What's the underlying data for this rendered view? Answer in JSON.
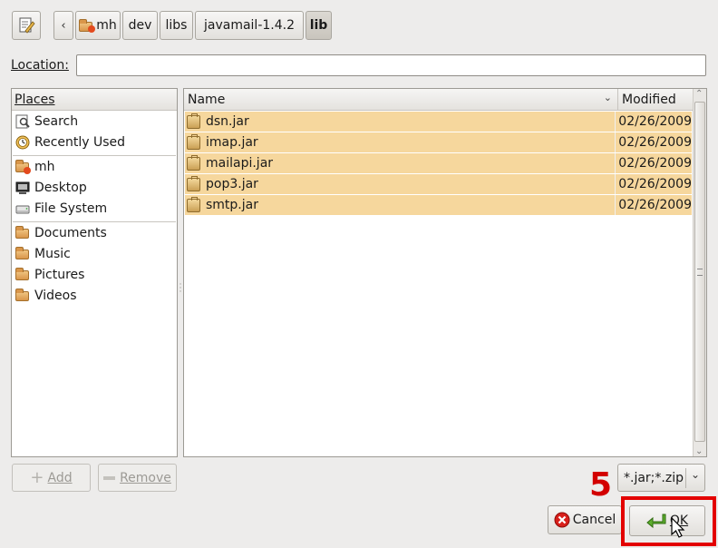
{
  "path_bar": {
    "buttons": [
      "mh",
      "dev",
      "libs",
      "javamail-1.4.2",
      "lib"
    ]
  },
  "location": {
    "label": "Location:",
    "value": ""
  },
  "places": {
    "header": "Places",
    "items": [
      {
        "label": "Search",
        "icon": "search-icon"
      },
      {
        "label": "Recently Used",
        "icon": "recent-icon"
      },
      {
        "label": "mh",
        "icon": "home-folder-icon"
      },
      {
        "label": "Desktop",
        "icon": "desktop-icon"
      },
      {
        "label": "File System",
        "icon": "drive-icon"
      },
      {
        "label": "Documents",
        "icon": "folder-icon"
      },
      {
        "label": "Music",
        "icon": "folder-icon"
      },
      {
        "label": "Pictures",
        "icon": "folder-icon"
      },
      {
        "label": "Videos",
        "icon": "folder-icon"
      }
    ],
    "add_label": "Add",
    "remove_label": "Remove"
  },
  "files": {
    "columns": {
      "name": "Name",
      "modified": "Modified"
    },
    "rows": [
      {
        "name": "dsn.jar",
        "modified": "02/26/2009"
      },
      {
        "name": "imap.jar",
        "modified": "02/26/2009"
      },
      {
        "name": "mailapi.jar",
        "modified": "02/26/2009"
      },
      {
        "name": "pop3.jar",
        "modified": "02/26/2009"
      },
      {
        "name": "smtp.jar",
        "modified": "02/26/2009"
      }
    ]
  },
  "filter": {
    "value": "*.jar;*.zip"
  },
  "step_number": "5",
  "actions": {
    "cancel_label": "Cancel",
    "ok_label": "OK"
  },
  "colors": {
    "selection": "#f6d79d",
    "highlight": "#e30000",
    "step": "#d30000"
  }
}
